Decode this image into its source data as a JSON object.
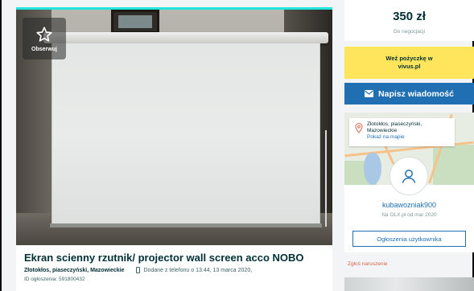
{
  "listing": {
    "watch_label": "Obserwuj",
    "title": "Ekran scienny rzutnik/ projector wall screen acco NOBO",
    "location": "Złotokłos, piaseczyński, Mazowieckie",
    "added": "Dodane z telefonu  o 13:44, 13 marca 2020,",
    "ad_id": "ID ogłoszenia: 591800432"
  },
  "sidebar": {
    "price": "350 zł",
    "negotiable": "Do negocjacji",
    "loan_line1": "Weź pożyczkę w",
    "loan_line2": "vivus.pl",
    "message_button": "Napisz wiadomość",
    "map_location_line1": "Złotokłos, piaseczyński,",
    "map_location_line2": "Mazowieckie",
    "map_link": "Pokaż na mapie",
    "username": "kubawozniak900",
    "member_since": "Na OLX.pl od mar 2020",
    "user_ads_button": "Ogłoszenia użytkownika",
    "report": "Zgłoś naruszenie"
  },
  "colors": {
    "accent": "#23e5db",
    "loan_bg": "#ffe55c",
    "message_bg": "#1f6fb2",
    "report": "#d8664f"
  },
  "icons": [
    "star-icon",
    "phone-icon",
    "envelope-icon",
    "location-pin-icon",
    "user-icon"
  ]
}
